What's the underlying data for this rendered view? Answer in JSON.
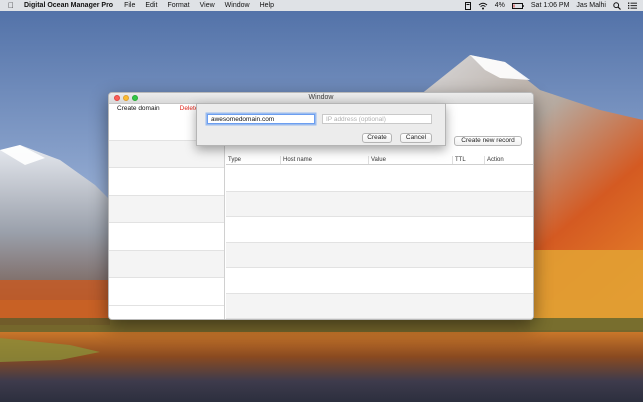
{
  "menubar": {
    "app_name": "Digital Ocean Manager Pro",
    "menus": [
      "File",
      "Edit",
      "Format",
      "View",
      "Window",
      "Help"
    ],
    "battery_text": "4%",
    "clock": "Sat 1:06 PM",
    "user": "Jas Malhi",
    "status_icons": [
      "apple-icon",
      "document-icon",
      "wifi-icon",
      "battery-icon",
      "search-icon",
      "list-icon"
    ]
  },
  "window": {
    "title": "Window"
  },
  "left_toolbar": {
    "create_label": "Create domain",
    "delete_label": "Delete d"
  },
  "right": {
    "new_record_label": "Create new record",
    "columns": [
      "Type",
      "Host name",
      "Value",
      "TTL",
      "Action"
    ]
  },
  "sheet": {
    "domain_value": "awesomedomain.com",
    "ip_placeholder": "IP address (optional)",
    "create_label": "Create",
    "cancel_label": "Cancel"
  },
  "colors": {
    "delete_red": "#e0261b",
    "focus_blue": "#6c9ef0",
    "close": "#fc5f57",
    "minimize": "#fdbc2e",
    "maximize": "#33c748"
  }
}
